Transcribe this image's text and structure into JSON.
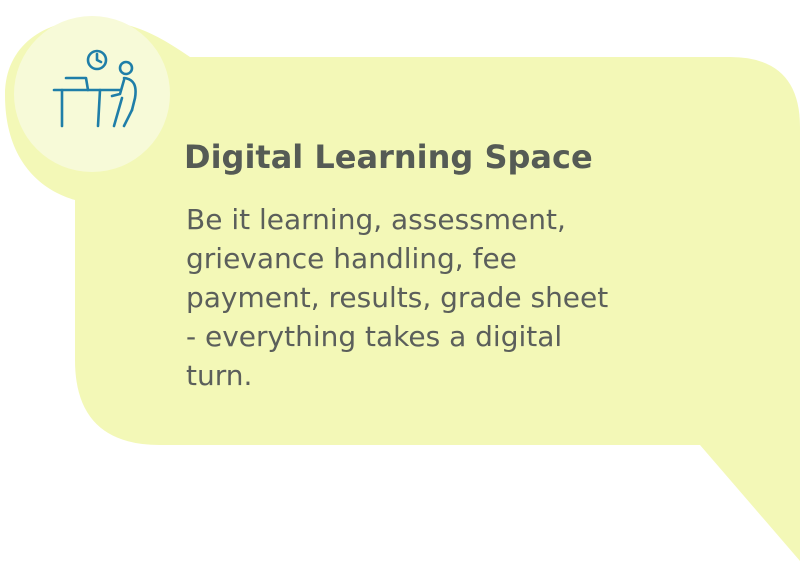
{
  "card": {
    "title": "Digital Learning Space",
    "description": "Be it learning, assessment, grievance handling, fee payment, results, grade sheet - everything takes a digital turn.",
    "icon": "person-at-desk-with-clock-icon"
  },
  "colors": {
    "card_background": "#f3f8b7",
    "icon_circle": "#f7fad8",
    "icon_stroke": "#1f7ea8",
    "title_text": "#555b55",
    "body_text": "#5b5f5b",
    "page_background": "#ffffff"
  }
}
